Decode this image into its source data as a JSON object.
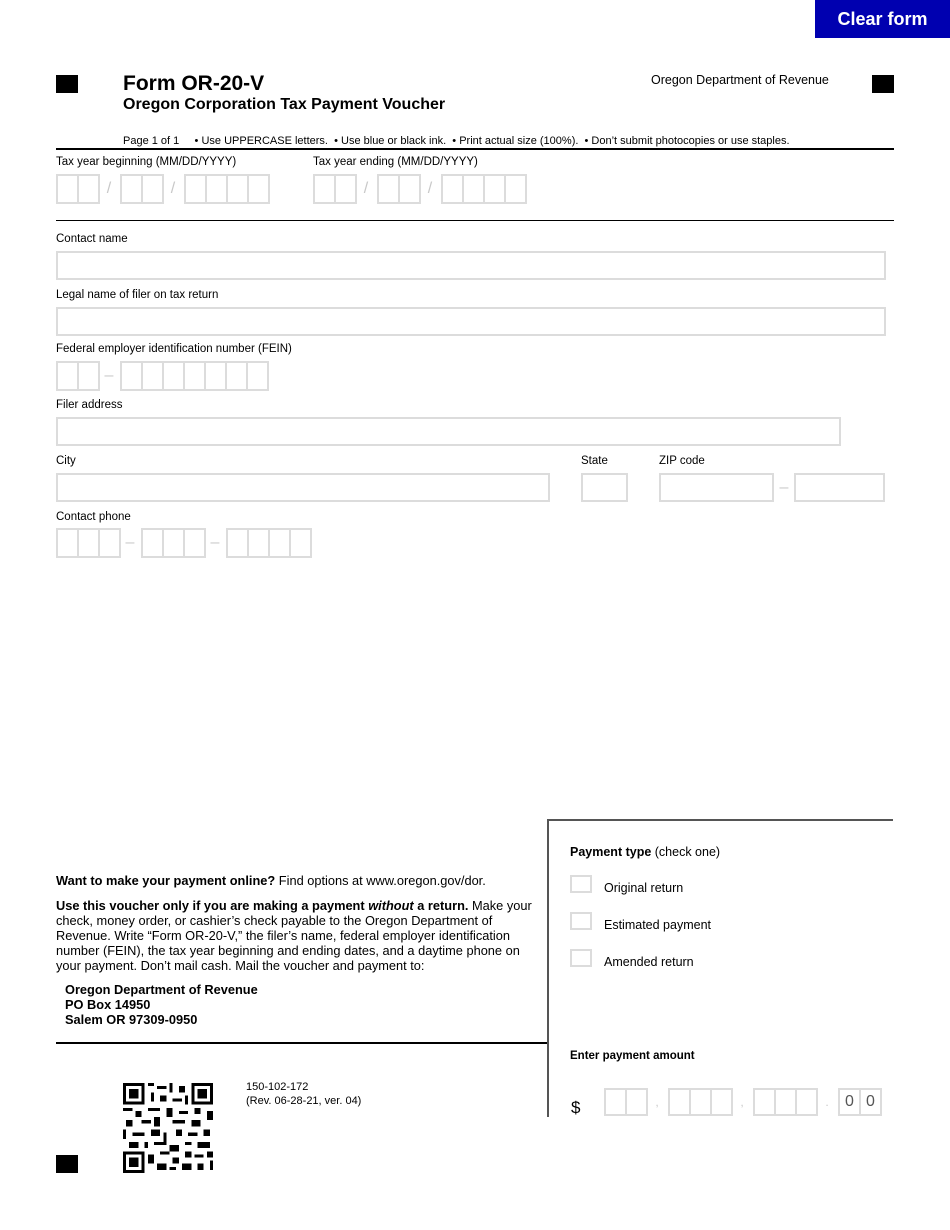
{
  "toolbar": {
    "clear_label": "Clear form"
  },
  "header": {
    "form_title": "Form OR-20-V",
    "form_subtitle": "Oregon Corporation Tax Payment Voucher",
    "agency": "Oregon Department of Revenue",
    "instructions": "Page 1 of 1     • Use UPPERCASE letters.  • Use blue or black ink.  • Print actual size (100%).  • Don’t submit photocopies or use staples."
  },
  "fields": {
    "tax_year_beginning": {
      "label": "Tax year beginning (MM/DD/YYYY)",
      "value": ""
    },
    "tax_year_ending": {
      "label": "Tax year ending (MM/DD/YYYY)",
      "value": ""
    },
    "date_separator": "/",
    "dash_separator": "–",
    "contact_name": {
      "label": "Contact name",
      "value": ""
    },
    "legal_name": {
      "label": "Legal name of filer on tax return",
      "value": ""
    },
    "fein": {
      "label": "Federal employer identification number (FEIN)",
      "value": ""
    },
    "filer_address": {
      "label": "Filer address",
      "value": ""
    },
    "city": {
      "label": "City",
      "value": ""
    },
    "state": {
      "label": "State",
      "value": ""
    },
    "zip": {
      "label": "ZIP code",
      "value": ""
    },
    "contact_phone": {
      "label": "Contact phone",
      "value": ""
    }
  },
  "info": {
    "online_bold": "Want to make your payment online?",
    "online_text": " Find options at www.oregon.gov/dor.",
    "voucher_bold_1": "Use this voucher only if you are making a payment ",
    "voucher_italic": "without",
    "voucher_bold_2": " a return.",
    "voucher_text": " Make your check, money order, or cashier’s check payable to the Oregon Department of Revenue. Write “Form OR-20-V,” the filer’s name, federal employer identification number (FEIN), the tax year beginning and ending dates, and a daytime phone on your payment. Don’t mail cash. Mail the voucher and payment to:",
    "address_line_1": "Oregon Department of Revenue",
    "address_line_2": "PO Box 14950",
    "address_line_3": "Salem OR 97309-0950"
  },
  "payment": {
    "type_label_bold": "Payment type",
    "type_label_note": " (check one)",
    "options": [
      {
        "label": "Original return",
        "checked": false
      },
      {
        "label": "Estimated payment",
        "checked": false
      },
      {
        "label": "Amended return",
        "checked": false
      }
    ],
    "amount_label": "Enter payment amount",
    "currency": "$",
    "thousands_sep": ",",
    "decimal_sep": ".",
    "cents": [
      "0",
      "0"
    ]
  },
  "footer": {
    "form_number": "150-102-172",
    "revision": "(Rev. 06-28-21, ver. 04)"
  }
}
